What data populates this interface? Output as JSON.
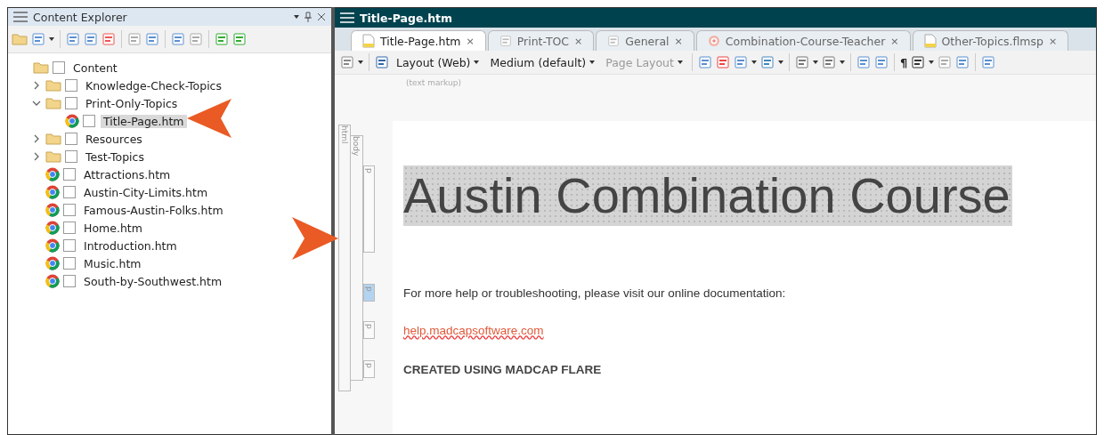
{
  "explorer": {
    "title": "Content Explorer",
    "tree": [
      {
        "label": "Content",
        "kind": "folder",
        "checked": false,
        "selected": false,
        "children": [
          {
            "label": "Knowledge-Check-Topics",
            "kind": "folder",
            "expanded": false,
            "checked": false,
            "selected": false
          },
          {
            "label": "Print-Only-Topics",
            "kind": "folder",
            "expanded": true,
            "checked": false,
            "selected": false,
            "children": [
              {
                "label": "Title-Page.htm",
                "kind": "file",
                "checked": false,
                "selected": true
              }
            ]
          },
          {
            "label": "Resources",
            "kind": "folder",
            "expanded": false,
            "checked": false,
            "selected": false
          },
          {
            "label": "Test-Topics",
            "kind": "folder",
            "expanded": false,
            "checked": false,
            "selected": false
          },
          {
            "label": "Attractions.htm",
            "kind": "file",
            "checked": false,
            "selected": false
          },
          {
            "label": "Austin-City-Limits.htm",
            "kind": "file",
            "checked": false,
            "selected": false
          },
          {
            "label": "Famous-Austin-Folks.htm",
            "kind": "file",
            "checked": false,
            "selected": false
          },
          {
            "label": "Home.htm",
            "kind": "file",
            "checked": false,
            "selected": false
          },
          {
            "label": "Introduction.htm",
            "kind": "file",
            "checked": false,
            "selected": false
          },
          {
            "label": "Music.htm",
            "kind": "file",
            "checked": false,
            "selected": false
          },
          {
            "label": "South-by-Southwest.htm",
            "kind": "file",
            "checked": false,
            "selected": false
          }
        ]
      }
    ]
  },
  "editor": {
    "title": "Title-Page.htm",
    "tabs": [
      {
        "label": "Title-Page.htm",
        "kind": "topic",
        "selected": true,
        "close": "×"
      },
      {
        "label": "Print-TOC",
        "kind": "toc",
        "selected": false,
        "close": "×"
      },
      {
        "label": "General",
        "kind": "skin",
        "selected": false,
        "close": "×"
      },
      {
        "label": "Combination-Course-Teacher",
        "kind": "target",
        "selected": false,
        "close": "×"
      },
      {
        "label": "Other-Topics.flmsp",
        "kind": "topic",
        "selected": false,
        "close": "×"
      }
    ],
    "dropdowns": [
      {
        "label": "Layout (Web)",
        "disabled": false
      },
      {
        "label": "Medium (default)",
        "disabled": false
      },
      {
        "label": "Page Layout",
        "disabled": true
      }
    ],
    "pilcrow": "¶",
    "markup_hint": "(text markup)",
    "structure": {
      "html": "html",
      "body": "body"
    },
    "blocks": [
      {
        "kind": "heading",
        "tag": "p",
        "text": "Austin Combination Course",
        "selected": false
      },
      {
        "kind": "paragraph",
        "tag": "p",
        "text": "For more help or troubleshooting, please visit our online documentation:",
        "selected": true
      },
      {
        "kind": "link",
        "tag": "p",
        "text": "help.madcapsoftware.com",
        "selected": false
      },
      {
        "kind": "caps",
        "tag": "p",
        "text": "CREATED USING MADCAP FLARE",
        "selected": false
      }
    ]
  }
}
